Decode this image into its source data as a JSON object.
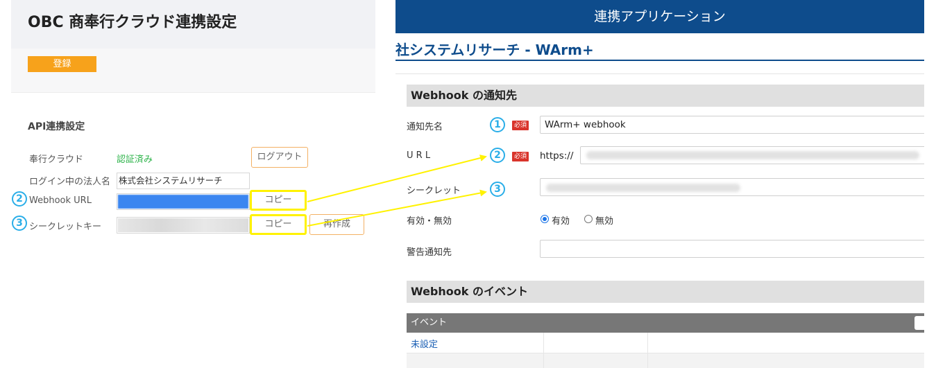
{
  "left": {
    "title": "OBC 商奉行クラウド連携設定",
    "register_button": "登録",
    "section_title": "API連携設定",
    "bugyo_label": "奉行クラウド",
    "bugyo_status": "認証済み",
    "logout_button": "ログアウト",
    "corp_label": "ログイン中の法人名",
    "corp_value": "株式会社システムリサーチ",
    "webhook_label": "Webhook URL",
    "secret_label": "シークレットキー",
    "copy_button": "コピー",
    "regen_button": "再作成"
  },
  "right": {
    "topbar_title": "連携アプリケーション",
    "company": "社システムリサーチ - WArm+",
    "webhook_section": "Webhook の通知先",
    "required_badge": "必須",
    "name_label": "通知先名",
    "name_value": "WArm+ webhook",
    "url_label": "U R L",
    "url_prefix": "https://",
    "secret_label": "シークレット",
    "enable_label": "有効・無効",
    "radio_enabled": "有効",
    "radio_disabled": "無効",
    "warn_label": "警告通知先",
    "event_section": "Webhook のイベント",
    "event_column": "イベント",
    "unset_link": "未設定"
  },
  "annotations": {
    "n1": "1",
    "n2": "2",
    "n3": "3",
    "marker_color": "#2aaee8",
    "highlight_color": "#fff200"
  }
}
